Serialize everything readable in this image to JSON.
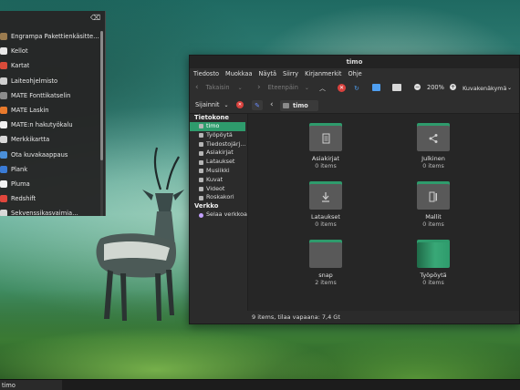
{
  "app_menu": {
    "items": [
      {
        "label": "Engrampa Pakettienkäsitte…",
        "icon": "archive-icon",
        "color": "#9a7b4f"
      },
      {
        "label": "Kellot",
        "icon": "clock-icon",
        "color": "#e8e8e8"
      },
      {
        "label": "Kartat",
        "icon": "map-icon",
        "color": "#d94b3a"
      },
      {
        "label": "Laiteohjelmisto",
        "icon": "firmware-icon",
        "color": "#cfcfcf"
      },
      {
        "label": "MATE Fonttikatselin",
        "icon": "font-icon",
        "color": "#8c8c8c"
      },
      {
        "label": "MATE Laskin",
        "icon": "calculator-icon",
        "color": "#e87a2c"
      },
      {
        "label": "MATE:n hakutyökalu",
        "icon": "search-tool-icon",
        "color": "#f0f0f0"
      },
      {
        "label": "Merkkikartta",
        "icon": "charmap-icon",
        "color": "#d8d8d8"
      },
      {
        "label": "Ota kuvakaappaus",
        "icon": "screenshot-icon",
        "color": "#4a8fd9"
      },
      {
        "label": "Plank",
        "icon": "plank-icon",
        "color": "#3a7bd5"
      },
      {
        "label": "Pluma",
        "icon": "text-editor-icon",
        "color": "#f2f2f2"
      },
      {
        "label": "Redshift",
        "icon": "redshift-icon",
        "color": "#e0463c"
      },
      {
        "label": "Sekvenssikasvaimia…",
        "icon": "app-icon",
        "color": "#d8d8d8"
      }
    ]
  },
  "window": {
    "title": "timo",
    "menu": [
      "Tiedosto",
      "Muokkaa",
      "Näytä",
      "Siirry",
      "Kirjanmerkit",
      "Ohje"
    ],
    "back_label": "Takaisin",
    "forward_label": "Eteenpäin",
    "zoom": "200%",
    "view_mode": "Kuvakenäkymä",
    "places_label": "Sijainnit",
    "breadcrumb": "timo",
    "sidebar": {
      "computer_header": "Tietokone",
      "computer_items": [
        "timo",
        "Työpöytä",
        "Tiedostojärj…",
        "Asiakirjat",
        "Lataukset",
        "Musiikki",
        "Kuvat",
        "Videot",
        "Roskakori"
      ],
      "network_header": "Verkko",
      "network_items": [
        "Selaa verkkoa"
      ]
    },
    "files": [
      {
        "name": "Asiakirjat",
        "count": "0 items",
        "icon": "document-icon"
      },
      {
        "name": "Julkinen",
        "count": "0 items",
        "icon": "share-icon"
      },
      {
        "name": "Lataukset",
        "count": "0 items",
        "icon": "download-icon"
      },
      {
        "name": "Mallit",
        "count": "0 items",
        "icon": "template-icon"
      },
      {
        "name": "snap",
        "count": "2 items",
        "icon": "folder-icon"
      },
      {
        "name": "Työpöytä",
        "count": "0 items",
        "icon": "desktop-folder-icon"
      }
    ],
    "status": "9 items, tilaa vapaana: 7,4 Gt"
  },
  "taskbar": {
    "task_label": "timo"
  },
  "colors": {
    "accent": "#2e9b6c"
  }
}
